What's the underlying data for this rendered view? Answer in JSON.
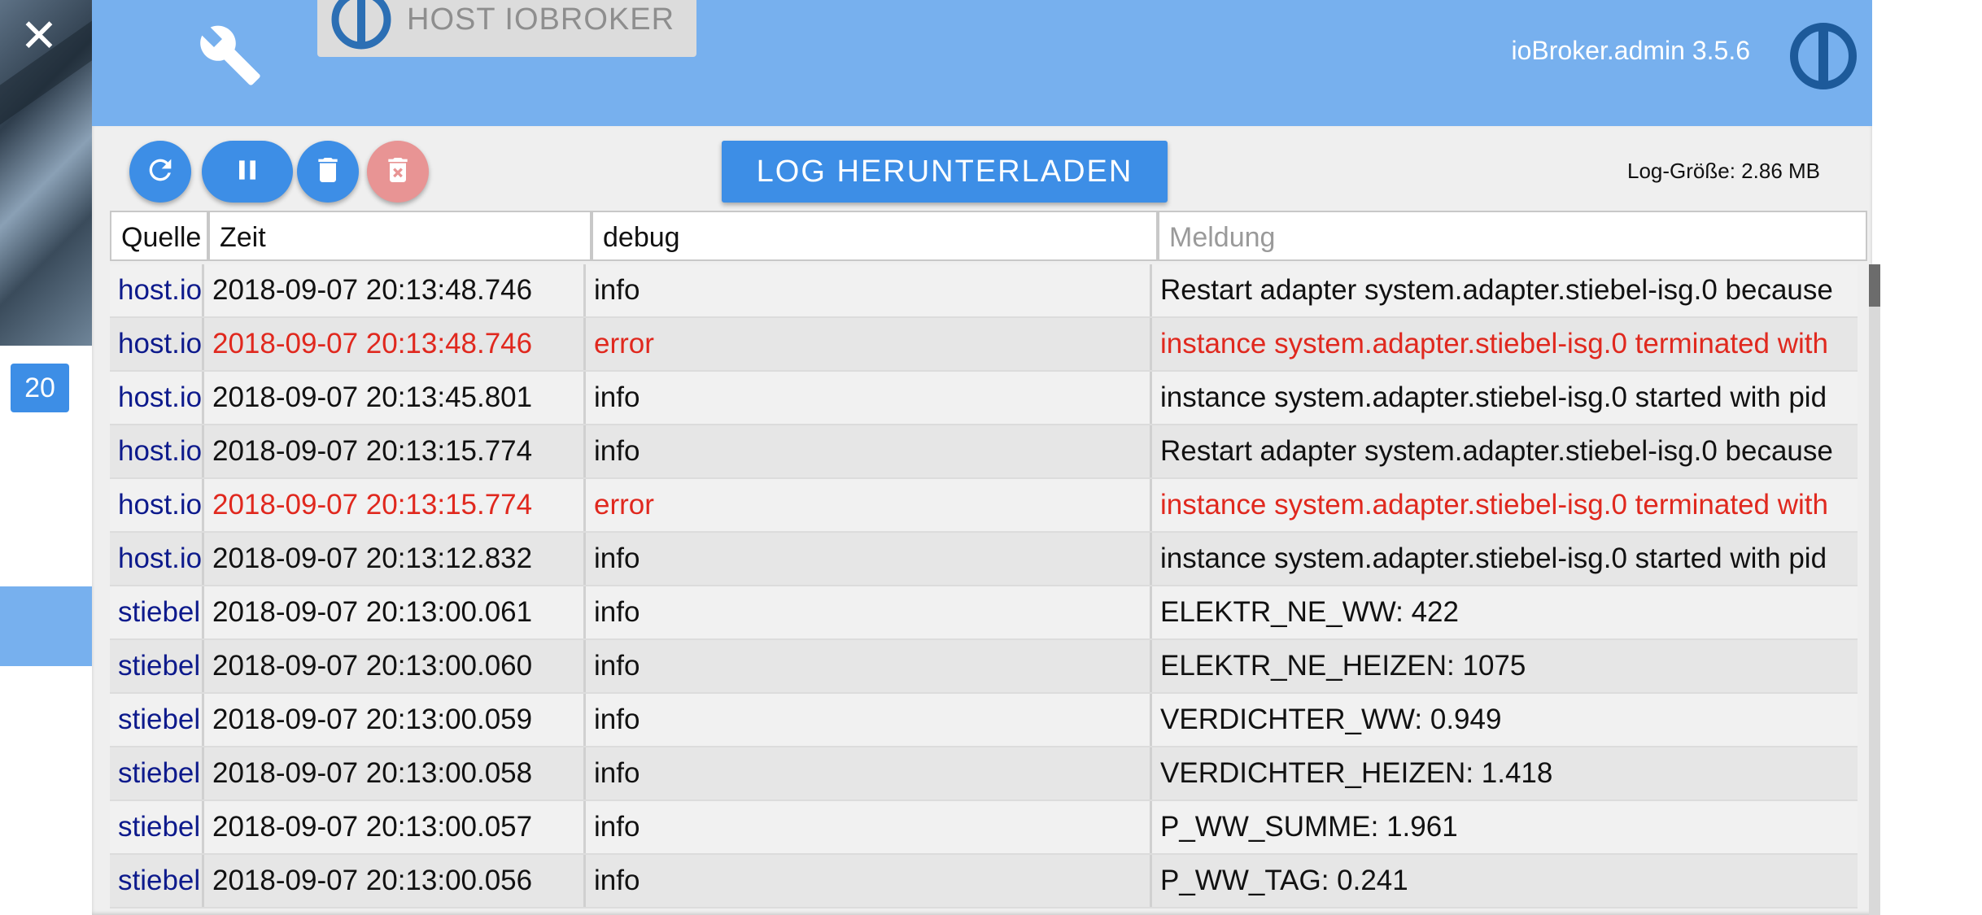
{
  "sidebar": {
    "count_badge": "20"
  },
  "header": {
    "host_tab_label": "HOST IOBROKER",
    "admin_version": "ioBroker.admin 3.5.6"
  },
  "toolbar": {
    "download_label": "LOG HERUNTERLADEN",
    "log_size": "Log-Größe: 2.86 MB",
    "icons": [
      "refresh-icon",
      "pause-icon",
      "delete-icon",
      "delete-forever-icon"
    ]
  },
  "filters": {
    "source": "Quelle",
    "time": "Zeit",
    "severity": "debug",
    "message_placeholder": "Meldung"
  },
  "colors": {
    "header": "#77b0ee",
    "primary": "#3d8ee6",
    "error": "#e0281e",
    "source": "#0d1a8c"
  },
  "rows": [
    {
      "src": "host.io",
      "time": "2018-09-07 20:13:48.746",
      "sev": "info",
      "msg": "Restart adapter system.adapter.stiebel-isg.0 because",
      "error": false
    },
    {
      "src": "host.io",
      "time": "2018-09-07 20:13:48.746",
      "sev": "error",
      "msg": "instance system.adapter.stiebel-isg.0 terminated with",
      "error": true
    },
    {
      "src": "host.io",
      "time": "2018-09-07 20:13:45.801",
      "sev": "info",
      "msg": "instance system.adapter.stiebel-isg.0 started with pid",
      "error": false
    },
    {
      "src": "host.io",
      "time": "2018-09-07 20:13:15.774",
      "sev": "info",
      "msg": "Restart adapter system.adapter.stiebel-isg.0 because",
      "error": false
    },
    {
      "src": "host.io",
      "time": "2018-09-07 20:13:15.774",
      "sev": "error",
      "msg": "instance system.adapter.stiebel-isg.0 terminated with",
      "error": true
    },
    {
      "src": "host.io",
      "time": "2018-09-07 20:13:12.832",
      "sev": "info",
      "msg": "instance system.adapter.stiebel-isg.0 started with pid",
      "error": false
    },
    {
      "src": "stiebel",
      "time": "2018-09-07 20:13:00.061",
      "sev": "info",
      "msg": "ELEKTR_NE_WW: 422",
      "error": false
    },
    {
      "src": "stiebel",
      "time": "2018-09-07 20:13:00.060",
      "sev": "info",
      "msg": "ELEKTR_NE_HEIZEN: 1075",
      "error": false
    },
    {
      "src": "stiebel",
      "time": "2018-09-07 20:13:00.059",
      "sev": "info",
      "msg": "VERDICHTER_WW: 0.949",
      "error": false
    },
    {
      "src": "stiebel",
      "time": "2018-09-07 20:13:00.058",
      "sev": "info",
      "msg": "VERDICHTER_HEIZEN: 1.418",
      "error": false
    },
    {
      "src": "stiebel",
      "time": "2018-09-07 20:13:00.057",
      "sev": "info",
      "msg": "P_WW_SUMME: 1.961",
      "error": false
    },
    {
      "src": "stiebel",
      "time": "2018-09-07 20:13:00.056",
      "sev": "info",
      "msg": "P_WW_TAG: 0.241",
      "error": false
    }
  ]
}
